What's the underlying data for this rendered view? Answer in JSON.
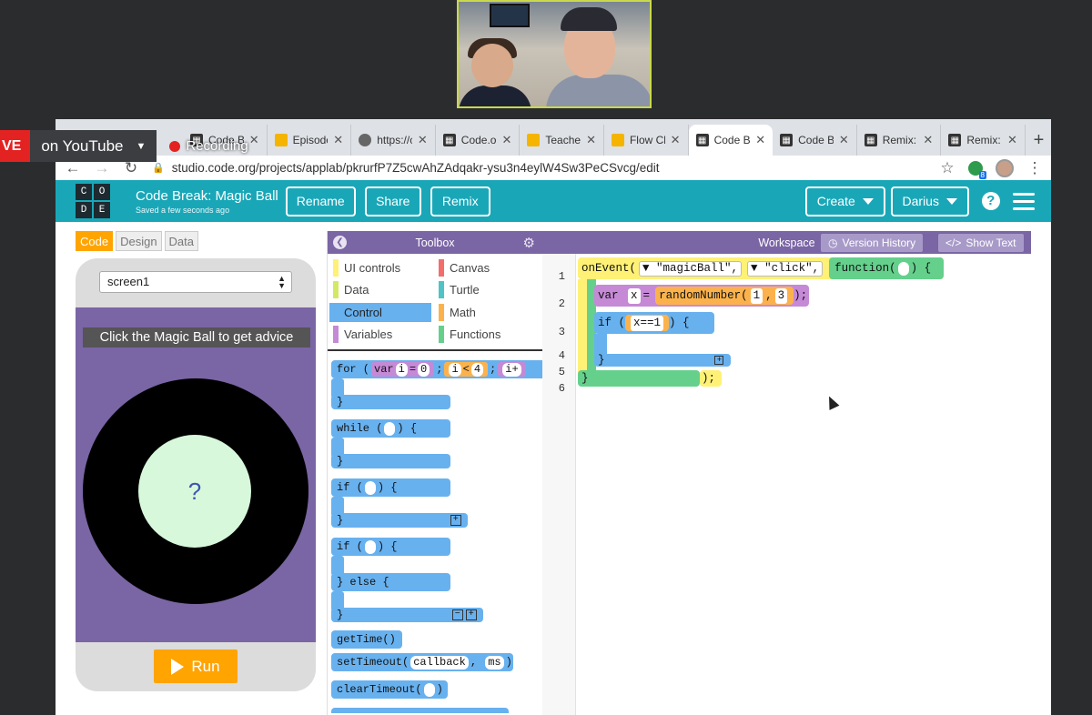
{
  "stream": {
    "live_label": "VE",
    "platform_label": "on YouTube",
    "recording_label": "Recording"
  },
  "tabs": [
    {
      "label": "Code B",
      "icon": "code-icon"
    },
    {
      "label": "Episode",
      "icon": "slides-icon"
    },
    {
      "label": "https://c",
      "icon": "globe-icon"
    },
    {
      "label": "Code.o",
      "icon": "code-icon"
    },
    {
      "label": "Teacher",
      "icon": "slides-icon"
    },
    {
      "label": "Flow Ch",
      "icon": "slides-icon"
    },
    {
      "label": "Code B",
      "icon": "code-icon",
      "active": true
    },
    {
      "label": "Code B",
      "icon": "code-icon"
    },
    {
      "label": "Remix:",
      "icon": "code-icon"
    },
    {
      "label": "Remix:",
      "icon": "code-icon"
    }
  ],
  "address": {
    "url": "studio.code.org/projects/applab/pkrurfP7Z5cwAhZAdqakr-ysu3n4eylW4Sw3PeCSvcg/edit",
    "ext_badge": "8"
  },
  "header": {
    "logo_letters": [
      "C",
      "O",
      "D",
      "E"
    ],
    "project_name": "Code Break: Magic Ball",
    "saved_status": "Saved a few seconds ago",
    "rename_label": "Rename",
    "share_label": "Share",
    "remix_label": "Remix",
    "create_label": "Create",
    "user_label": "Darius",
    "help_label": "?"
  },
  "modes": [
    "Code",
    "Design",
    "Data"
  ],
  "app": {
    "screen_select": "screen1",
    "advice_text": "Click the Magic Ball to get advice",
    "ball_text": "?",
    "run_label": "Run"
  },
  "toolbox": {
    "title": "Toolbox",
    "categories": [
      {
        "label": "UI controls",
        "color": "#fff176"
      },
      {
        "label": "Canvas",
        "color": "#f46d6d"
      },
      {
        "label": "Data",
        "color": "#d3e965"
      },
      {
        "label": "Turtle",
        "color": "#4fc3c6"
      },
      {
        "label": "Control",
        "color": "#68b1ef",
        "selected": true
      },
      {
        "label": "Math",
        "color": "#fcb24c"
      },
      {
        "label": "Variables",
        "color": "#c589d6"
      },
      {
        "label": "Functions",
        "color": "#64d08c"
      }
    ],
    "blocks": {
      "for_kw": "for",
      "for_var": "var",
      "for_i": "i",
      "for_eq": "=",
      "for_zero": "0",
      "for_cond_i": "i",
      "for_lt": "<",
      "for_four": "4",
      "for_inc": "i+",
      "while_kw": "while",
      "open_brace": "{",
      "close_brace": "}",
      "if_kw": "if",
      "else_kw": "} else {",
      "gettime": "getTime()",
      "settimeout": "setTimeout(",
      "callback": "callback",
      "ms": "ms",
      "cleartimeout": "clearTimeout("
    }
  },
  "workspace": {
    "title": "Workspace",
    "version_history": "Version History",
    "show_text": "Show Text",
    "line_numbers": [
      "1",
      "2",
      "3",
      "4",
      "5",
      "6"
    ],
    "onevent": "onEvent(",
    "arg_id": "\"magicBall\",",
    "arg_event": "\"click\",",
    "function_kw": "function(",
    "fn_close": ") {",
    "var_kw": "var",
    "var_name": "x",
    "assign": "=",
    "random": "randomNumber(",
    "rand_min": "1",
    "rand_sep": ",",
    "rand_max": "3",
    "random_close": ");",
    "if_kw": "if (",
    "cond": "x==1",
    "if_close": ") {",
    "close_if": "}",
    "close_fn": "}",
    "close_event": ");"
  }
}
